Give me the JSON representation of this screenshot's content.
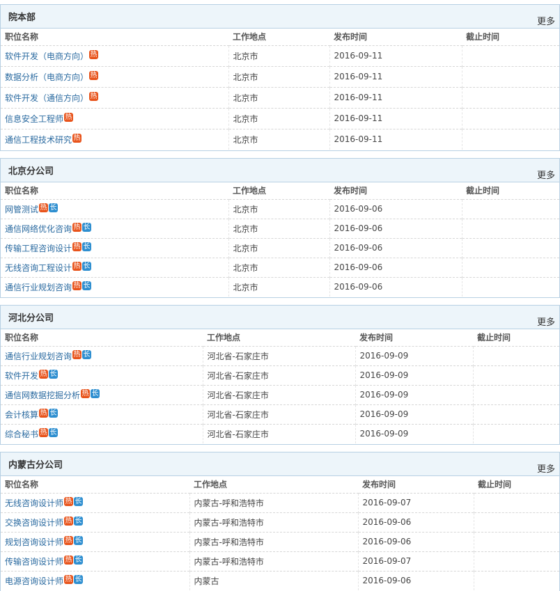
{
  "columns": {
    "name": "职位名称",
    "location": "工作地点",
    "date": "发布时间",
    "deadline": "截止时间"
  },
  "more_label": "更多",
  "badges": {
    "hot": "热",
    "long": "长"
  },
  "sections": [
    {
      "title": "院本部",
      "jobs": [
        {
          "name": "软件开发（电商方向）",
          "location": "北京市",
          "date": "2016-09-11",
          "deadline": ""
        },
        {
          "name": "数据分析（电商方向）",
          "location": "北京市",
          "date": "2016-09-11",
          "deadline": ""
        },
        {
          "name": "软件开发（通信方向）",
          "location": "北京市",
          "date": "2016-09-11",
          "deadline": ""
        },
        {
          "name": "信息安全工程师",
          "location": "北京市",
          "date": "2016-09-11",
          "deadline": ""
        },
        {
          "name": "通信工程技术研究",
          "location": "北京市",
          "date": "2016-09-11",
          "deadline": ""
        }
      ]
    },
    {
      "title": "北京分公司",
      "jobs": [
        {
          "name": "网管测试",
          "location": "北京市",
          "date": "2016-09-06",
          "deadline": ""
        },
        {
          "name": "通信网络优化咨询",
          "location": "北京市",
          "date": "2016-09-06",
          "deadline": ""
        },
        {
          "name": "传输工程咨询设计",
          "location": "北京市",
          "date": "2016-09-06",
          "deadline": ""
        },
        {
          "name": "无线咨询工程设计",
          "location": "北京市",
          "date": "2016-09-06",
          "deadline": ""
        },
        {
          "name": "通信行业规划咨询",
          "location": "北京市",
          "date": "2016-09-06",
          "deadline": ""
        }
      ]
    },
    {
      "title": "河北分公司",
      "jobs": [
        {
          "name": "通信行业规划咨询",
          "location": "河北省-石家庄市",
          "date": "2016-09-09",
          "deadline": ""
        },
        {
          "name": "软件开发",
          "location": "河北省-石家庄市",
          "date": "2016-09-09",
          "deadline": ""
        },
        {
          "name": "通信网数据挖掘分析",
          "location": "河北省-石家庄市",
          "date": "2016-09-09",
          "deadline": ""
        },
        {
          "name": "会计核算",
          "location": "河北省-石家庄市",
          "date": "2016-09-09",
          "deadline": ""
        },
        {
          "name": "综合秘书",
          "location": "河北省-石家庄市",
          "date": "2016-09-09",
          "deadline": ""
        }
      ]
    },
    {
      "title": "内蒙古分公司",
      "jobs": [
        {
          "name": "无线咨询设计师",
          "location": "内蒙古-呼和浩特市",
          "date": "2016-09-07",
          "deadline": ""
        },
        {
          "name": "交换咨询设计师",
          "location": "内蒙古-呼和浩特市",
          "date": "2016-09-06",
          "deadline": ""
        },
        {
          "name": "规划咨询设计师",
          "location": "内蒙古-呼和浩特市",
          "date": "2016-09-06",
          "deadline": ""
        },
        {
          "name": "传输咨询设计师",
          "location": "内蒙古-呼和浩特市",
          "date": "2016-09-07",
          "deadline": ""
        },
        {
          "name": "电源咨询设计师",
          "location": "内蒙古",
          "date": "2016-09-06",
          "deadline": ""
        }
      ]
    }
  ]
}
